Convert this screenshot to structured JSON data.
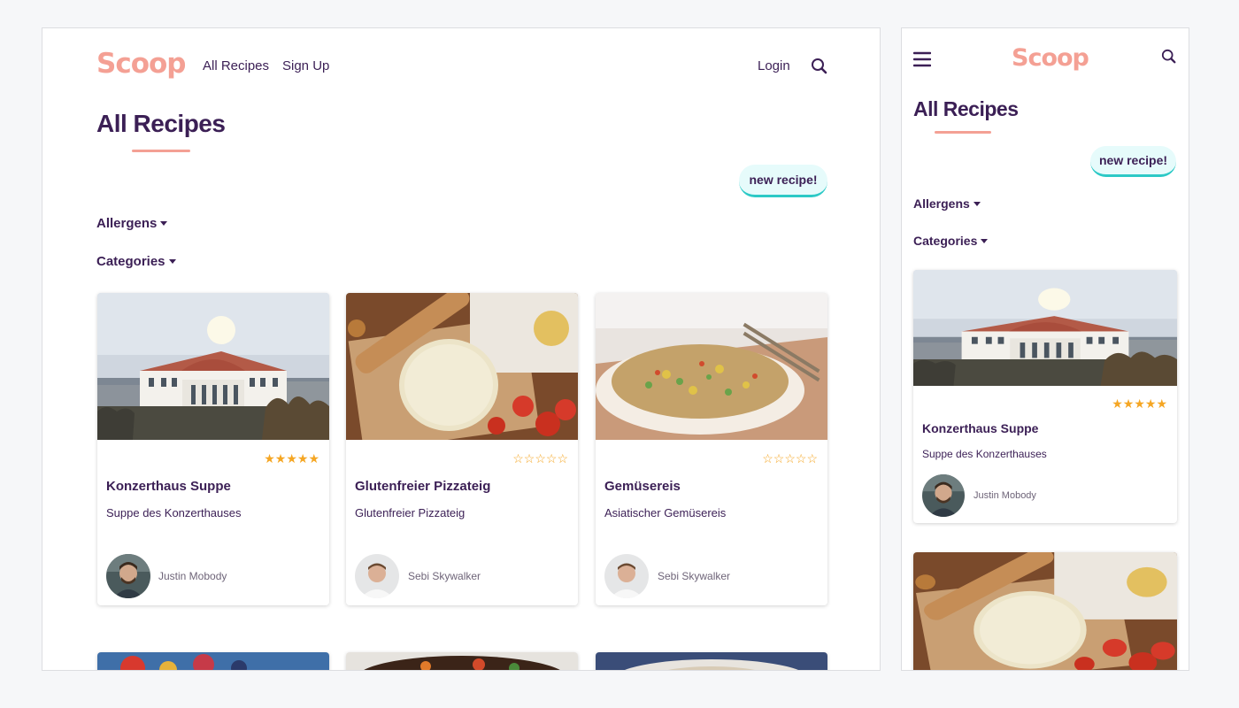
{
  "app": {
    "logo": "Scoop"
  },
  "nav": {
    "all_recipes": "All Recipes",
    "sign_up": "Sign Up",
    "login": "Login"
  },
  "page": {
    "title": "All Recipes",
    "new_recipe": "new recipe!"
  },
  "filters": {
    "allergens": "Allergens",
    "categories": "Categories"
  },
  "colors": {
    "brand": "#f4a094",
    "text": "#3b1f55",
    "accent": "#2cc9c6",
    "star": "#f5a623"
  },
  "recipes": [
    {
      "title": "Konzerthaus Suppe",
      "description": "Suppe des Konzerthauses",
      "author": "Justin Mobody",
      "rating": 5,
      "stars": "★★★★★"
    },
    {
      "title": "Glutenfreier Pizzateig",
      "description": "Glutenfreier Pizzateig",
      "author": "Sebi Skywalker",
      "rating": 0,
      "stars": "☆☆☆☆☆"
    },
    {
      "title": "Gemüsereis",
      "description": "Asiatischer Gemüsereis",
      "author": "Sebi Skywalker",
      "rating": 0,
      "stars": "☆☆☆☆☆"
    }
  ]
}
